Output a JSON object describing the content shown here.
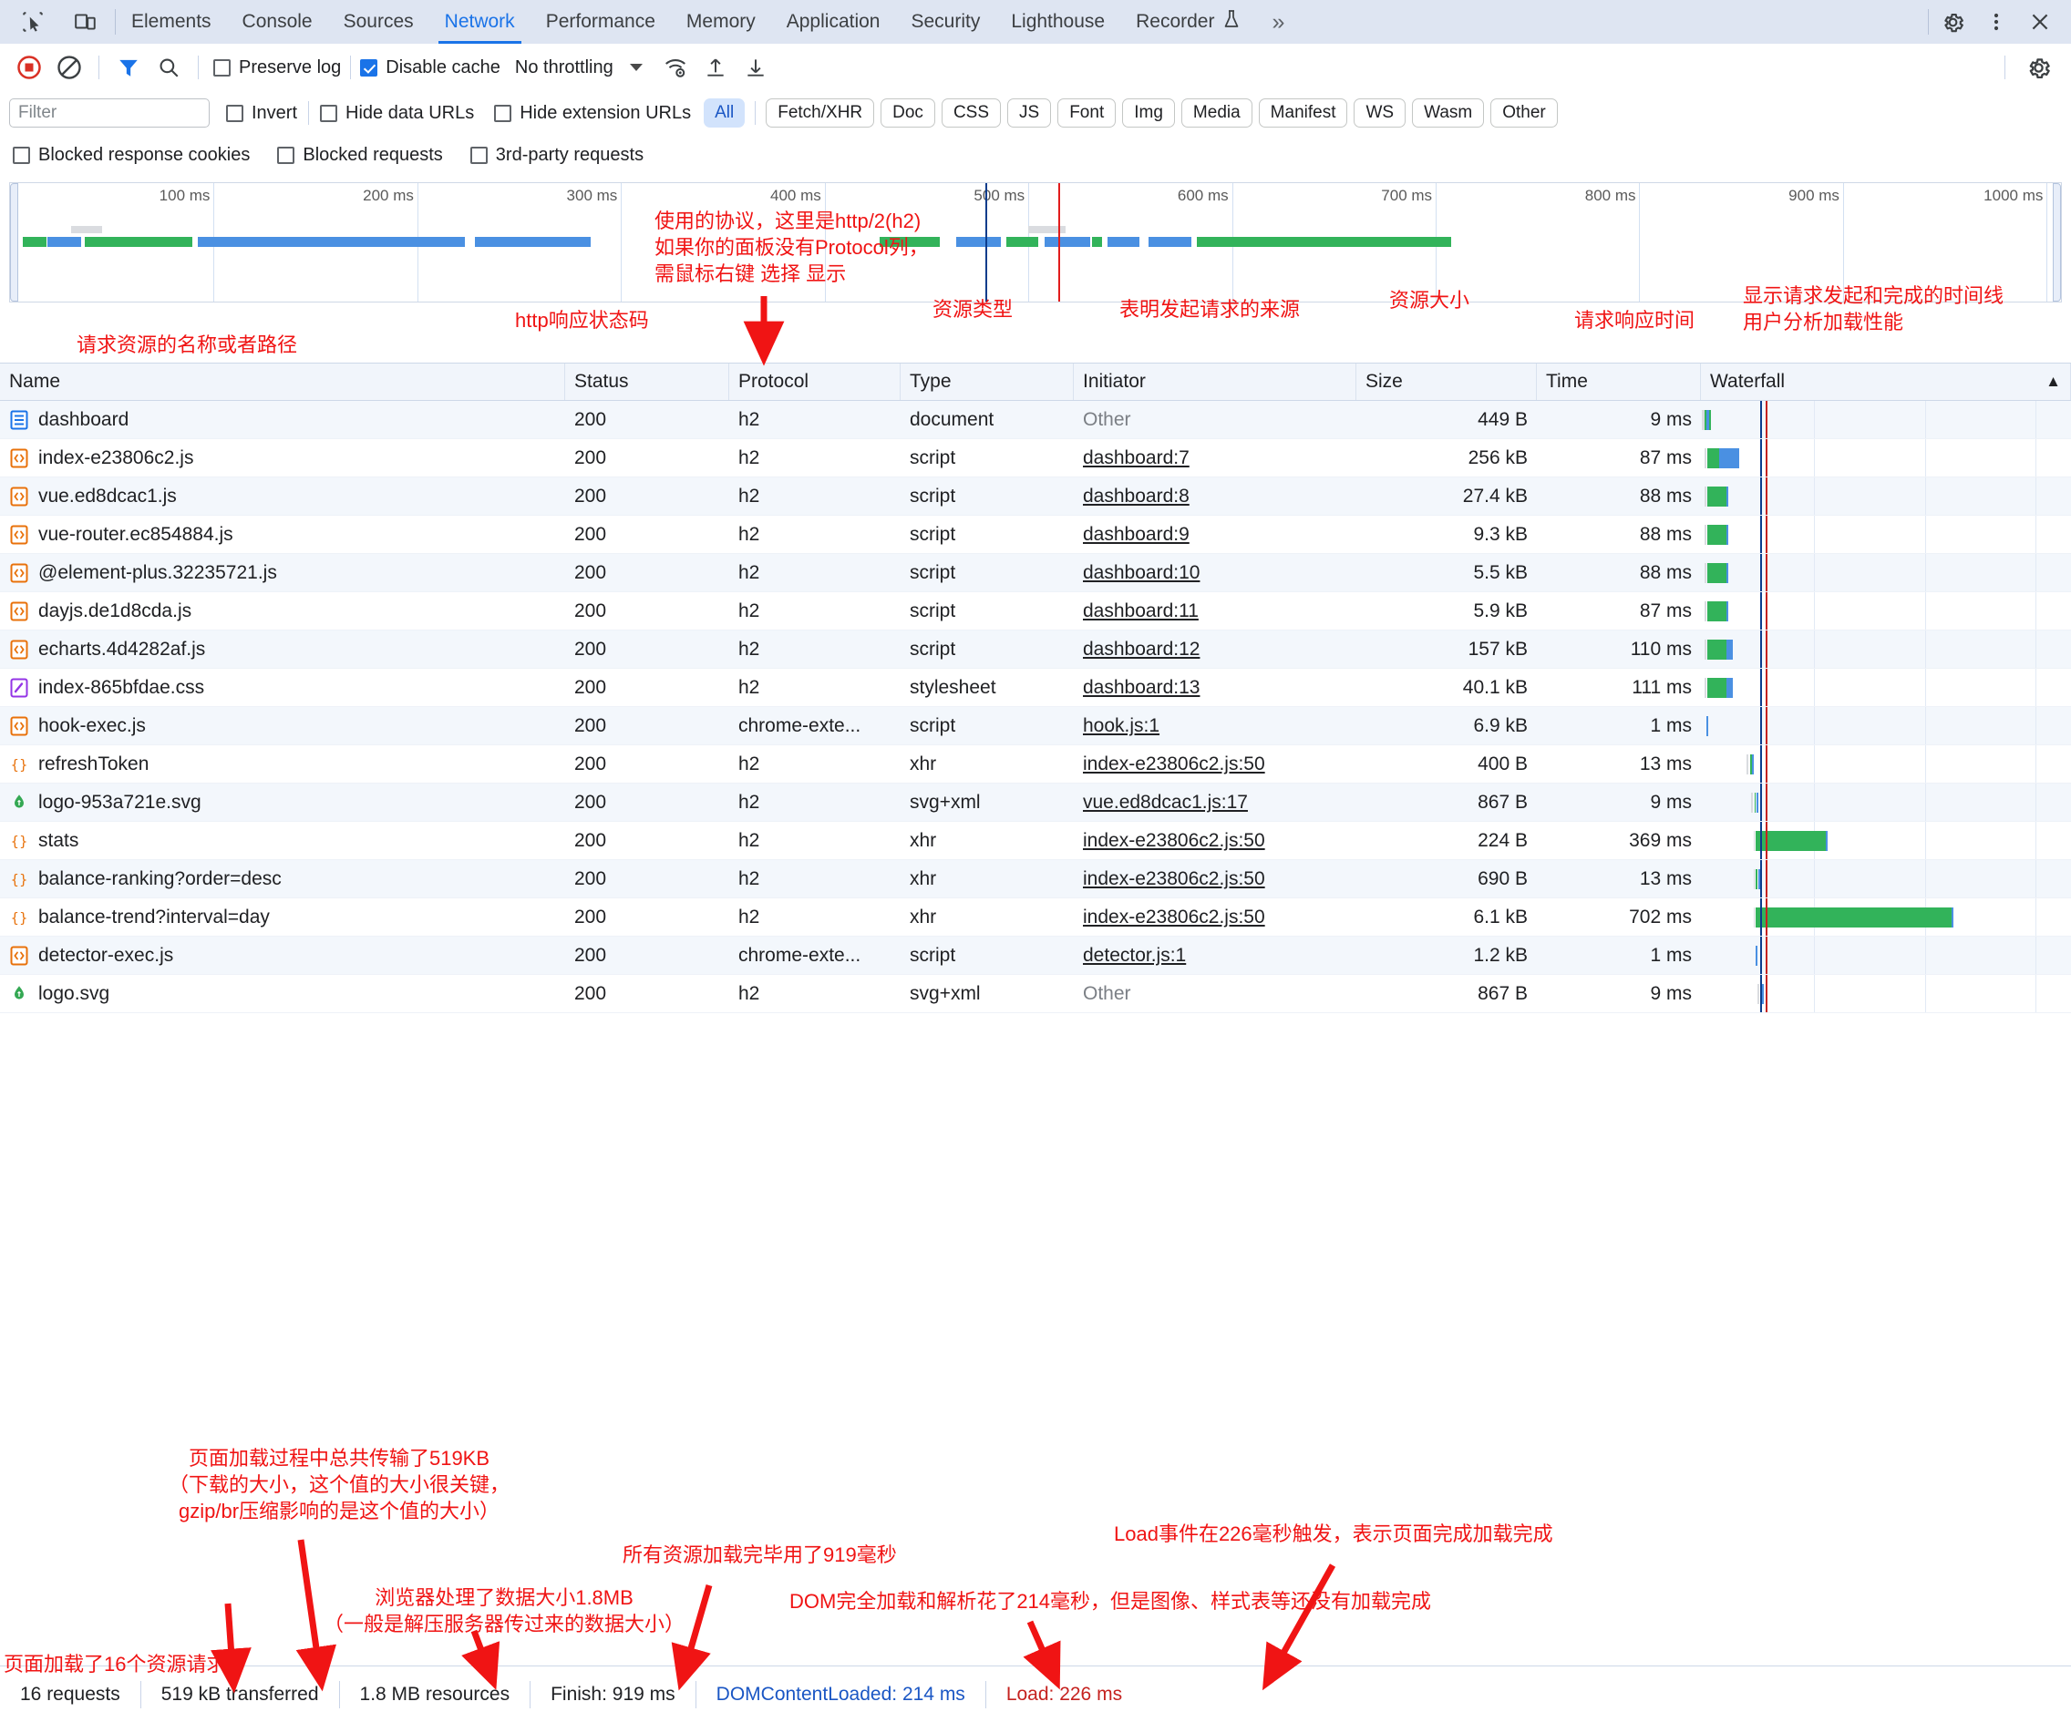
{
  "devtools": {
    "tabs": [
      {
        "label": "Elements",
        "active": false
      },
      {
        "label": "Console",
        "active": false
      },
      {
        "label": "Sources",
        "active": false
      },
      {
        "label": "Network",
        "active": true
      },
      {
        "label": "Performance",
        "active": false
      },
      {
        "label": "Memory",
        "active": false
      },
      {
        "label": "Application",
        "active": false
      },
      {
        "label": "Security",
        "active": false
      },
      {
        "label": "Lighthouse",
        "active": false
      },
      {
        "label": "Recorder",
        "active": false
      }
    ],
    "more_tabs_label": "»",
    "icons": {
      "inspect": "inspect-element-icon",
      "device": "device-toolbar-icon",
      "settings": "gear-icon",
      "menu": "kebab-menu-icon",
      "close": "close-icon",
      "beaker": "beaker-icon"
    }
  },
  "toolbar": {
    "record_label": "record-stop-icon",
    "clear_label": "clear-icon",
    "filter_label": "filter-icon",
    "search_label": "search-icon",
    "preserve_log": {
      "label": "Preserve log",
      "checked": false
    },
    "disable_cache": {
      "label": "Disable cache",
      "checked": true
    },
    "throttling": "No throttling",
    "import_label": "import-har-icon",
    "export_label": "export-har-icon",
    "wifi_label": "network-conditions-icon",
    "settings_label": "gear-icon"
  },
  "filters": {
    "placeholder": "Filter",
    "invert": {
      "label": "Invert",
      "checked": false
    },
    "hide_data_urls": {
      "label": "Hide data URLs",
      "checked": false
    },
    "hide_extension_urls": {
      "label": "Hide extension URLs",
      "checked": false
    },
    "types": [
      "All",
      "Fetch/XHR",
      "Doc",
      "CSS",
      "JS",
      "Font",
      "Img",
      "Media",
      "Manifest",
      "WS",
      "Wasm",
      "Other"
    ],
    "active_type": "All",
    "blocked_response_cookies": {
      "label": "Blocked response cookies",
      "checked": false
    },
    "blocked_requests": {
      "label": "Blocked requests",
      "checked": false
    },
    "third_party_requests": {
      "label": "3rd-party requests",
      "checked": false
    }
  },
  "overview": {
    "ticks": [
      "100 ms",
      "200 ms",
      "300 ms",
      "400 ms",
      "500 ms",
      "600 ms",
      "700 ms",
      "800 ms",
      "900 ms",
      "1000 ms"
    ]
  },
  "table": {
    "columns": [
      "Name",
      "Status",
      "Protocol",
      "Type",
      "Initiator",
      "Size",
      "Time",
      "Waterfall"
    ],
    "sort_indicator": "▲",
    "rows": [
      {
        "icon": "document-icon",
        "name": "dashboard",
        "status": "200",
        "protocol": "h2",
        "type": "document",
        "initiator": "Other",
        "initiator_link": false,
        "size": "449 B",
        "time": "9 ms"
      },
      {
        "icon": "script-icon",
        "name": "index-e23806c2.js",
        "status": "200",
        "protocol": "h2",
        "type": "script",
        "initiator": "dashboard:7",
        "initiator_link": true,
        "size": "256 kB",
        "time": "87 ms"
      },
      {
        "icon": "script-icon",
        "name": "vue.ed8dcac1.js",
        "status": "200",
        "protocol": "h2",
        "type": "script",
        "initiator": "dashboard:8",
        "initiator_link": true,
        "size": "27.4 kB",
        "time": "88 ms"
      },
      {
        "icon": "script-icon",
        "name": "vue-router.ec854884.js",
        "status": "200",
        "protocol": "h2",
        "type": "script",
        "initiator": "dashboard:9",
        "initiator_link": true,
        "size": "9.3 kB",
        "time": "88 ms"
      },
      {
        "icon": "script-icon",
        "name": "@element-plus.32235721.js",
        "status": "200",
        "protocol": "h2",
        "type": "script",
        "initiator": "dashboard:10",
        "initiator_link": true,
        "size": "5.5 kB",
        "time": "88 ms"
      },
      {
        "icon": "script-icon",
        "name": "dayjs.de1d8cda.js",
        "status": "200",
        "protocol": "h2",
        "type": "script",
        "initiator": "dashboard:11",
        "initiator_link": true,
        "size": "5.9 kB",
        "time": "87 ms"
      },
      {
        "icon": "script-icon",
        "name": "echarts.4d4282af.js",
        "status": "200",
        "protocol": "h2",
        "type": "script",
        "initiator": "dashboard:12",
        "initiator_link": true,
        "size": "157 kB",
        "time": "110 ms"
      },
      {
        "icon": "stylesheet-icon",
        "name": "index-865bfdae.css",
        "status": "200",
        "protocol": "h2",
        "type": "stylesheet",
        "initiator": "dashboard:13",
        "initiator_link": true,
        "size": "40.1 kB",
        "time": "111 ms"
      },
      {
        "icon": "script-icon",
        "name": "hook-exec.js",
        "status": "200",
        "protocol": "chrome-exte...",
        "type": "script",
        "initiator": "hook.js:1",
        "initiator_link": true,
        "size": "6.9 kB",
        "time": "1 ms"
      },
      {
        "icon": "xhr-icon",
        "name": "refreshToken",
        "status": "200",
        "protocol": "h2",
        "type": "xhr",
        "initiator": "index-e23806c2.js:50",
        "initiator_link": true,
        "size": "400 B",
        "time": "13 ms"
      },
      {
        "icon": "image-icon",
        "name": "logo-953a721e.svg",
        "status": "200",
        "protocol": "h2",
        "type": "svg+xml",
        "initiator": "vue.ed8dcac1.js:17",
        "initiator_link": true,
        "size": "867 B",
        "time": "9 ms"
      },
      {
        "icon": "xhr-icon",
        "name": "stats",
        "status": "200",
        "protocol": "h2",
        "type": "xhr",
        "initiator": "index-e23806c2.js:50",
        "initiator_link": true,
        "size": "224 B",
        "time": "369 ms"
      },
      {
        "icon": "xhr-icon",
        "name": "balance-ranking?order=desc",
        "status": "200",
        "protocol": "h2",
        "type": "xhr",
        "initiator": "index-e23806c2.js:50",
        "initiator_link": true,
        "size": "690 B",
        "time": "13 ms"
      },
      {
        "icon": "xhr-icon",
        "name": "balance-trend?interval=day",
        "status": "200",
        "protocol": "h2",
        "type": "xhr",
        "initiator": "index-e23806c2.js:50",
        "initiator_link": true,
        "size": "6.1 kB",
        "time": "702 ms"
      },
      {
        "icon": "script-icon",
        "name": "detector-exec.js",
        "status": "200",
        "protocol": "chrome-exte...",
        "type": "script",
        "initiator": "detector.js:1",
        "initiator_link": true,
        "size": "1.2 kB",
        "time": "1 ms"
      },
      {
        "icon": "image-icon",
        "name": "logo.svg",
        "status": "200",
        "protocol": "h2",
        "type": "svg+xml",
        "initiator": "Other",
        "initiator_link": false,
        "size": "867 B",
        "time": "9 ms"
      }
    ]
  },
  "statusbar": {
    "requests": "16 requests",
    "transferred": "519 kB transferred",
    "resources": "1.8 MB resources",
    "finish": "Finish: 919 ms",
    "dcl": "DOMContentLoaded: 214 ms",
    "load": "Load: 226 ms"
  },
  "annotations": {
    "name_col": "请求资源的名称或者路径",
    "status_col": "http响应状态码",
    "protocol_col": "使用的协议，这里是http/2(h2)\n如果你的面板没有Protocol列，\n需鼠标右键 选择 显示",
    "type_col": "资源类型",
    "initiator_col": "表明发起请求的来源",
    "size_col": "资源大小",
    "time_col": "请求响应时间",
    "waterfall_col": "显示请求发起和完成的时间线\n用户分析加载性能",
    "requests_note": "页面加载了16个资源请求",
    "transferred_note": "页面加载过程中总共传输了519KB\n（下载的大小，这个值的大小很关键，\ngzip/br压缩影响的是这个值的大小）",
    "resources_note": "浏览器处理了数据大小1.8MB\n（一般是解压服务器传过来的数据大小）",
    "finish_note": "所有资源加载完毕用了919毫秒",
    "dcl_note": "DOM完全加载和解析花了214毫秒，但是图像、样式表等还没有加载完成",
    "load_note": "Load事件在226毫秒触发，表示页面完成加载完成"
  },
  "colors": {
    "accent": "#1a73e8",
    "annotation": "#f01414",
    "wait": "#32b35a",
    "download": "#4a90e2",
    "dcl_line": "#0b3c8c",
    "load_line": "#c5221f"
  },
  "waterfall": {
    "dcl_x_pct": 16.0,
    "load_x_pct": 17.4,
    "bars": [
      {
        "queue": [
          0.3,
          0.6
        ],
        "wait": [
          1.0,
          1.6
        ],
        "dl": [
          1.6,
          0.5
        ]
      },
      {
        "queue": [
          1.0,
          0.5
        ],
        "wait": [
          1.8,
          3.2
        ],
        "dl": [
          5.0,
          5.4
        ]
      },
      {
        "queue": [
          1.0,
          0.5
        ],
        "wait": [
          1.8,
          5.0
        ],
        "dl": [
          6.8,
          0.7
        ]
      },
      {
        "queue": [
          1.0,
          0.5
        ],
        "wait": [
          1.8,
          5.0
        ],
        "dl": [
          6.8,
          0.7
        ]
      },
      {
        "queue": [
          1.0,
          0.5
        ],
        "wait": [
          1.8,
          5.2
        ],
        "dl": [
          7.0,
          0.5
        ]
      },
      {
        "queue": [
          1.0,
          0.5
        ],
        "wait": [
          1.8,
          5.0
        ],
        "dl": [
          6.8,
          0.7
        ]
      },
      {
        "queue": [
          1.0,
          0.5
        ],
        "wait": [
          1.8,
          5.2
        ],
        "dl": [
          7.0,
          1.6
        ]
      },
      {
        "queue": [
          1.0,
          0.5
        ],
        "wait": [
          1.8,
          5.2
        ],
        "dl": [
          7.0,
          1.6
        ]
      },
      {
        "queue": null,
        "wait": null,
        "dl": [
          1.5,
          0.5
        ]
      },
      {
        "queue": [
          12.4,
          0.4
        ],
        "wait": [
          13.2,
          0.7
        ],
        "dl": [
          13.9,
          0.4
        ]
      },
      {
        "queue": [
          13.6,
          0.4
        ],
        "wait": [
          14.5,
          0.3
        ],
        "dl": [
          15.0,
          0.5
        ]
      },
      {
        "queue": [
          14.2,
          0.3
        ],
        "wait": [
          14.8,
          19.0
        ],
        "dl": [
          33.8,
          0.5
        ]
      },
      {
        "queue": [
          14.2,
          0.3
        ],
        "wait": [
          14.8,
          0.5
        ],
        "dl": [
          15.4,
          0.5
        ]
      },
      {
        "queue": [
          14.2,
          0.3
        ],
        "wait": [
          14.8,
          53.0
        ],
        "dl": [
          67.8,
          0.5
        ]
      },
      {
        "queue": null,
        "wait": null,
        "dl": [
          14.9,
          0.4
        ]
      },
      {
        "queue": [
          15.3,
          0.3
        ],
        "wait": [
          15.9,
          0.5
        ],
        "dl": [
          16.5,
          0.5
        ]
      }
    ]
  }
}
